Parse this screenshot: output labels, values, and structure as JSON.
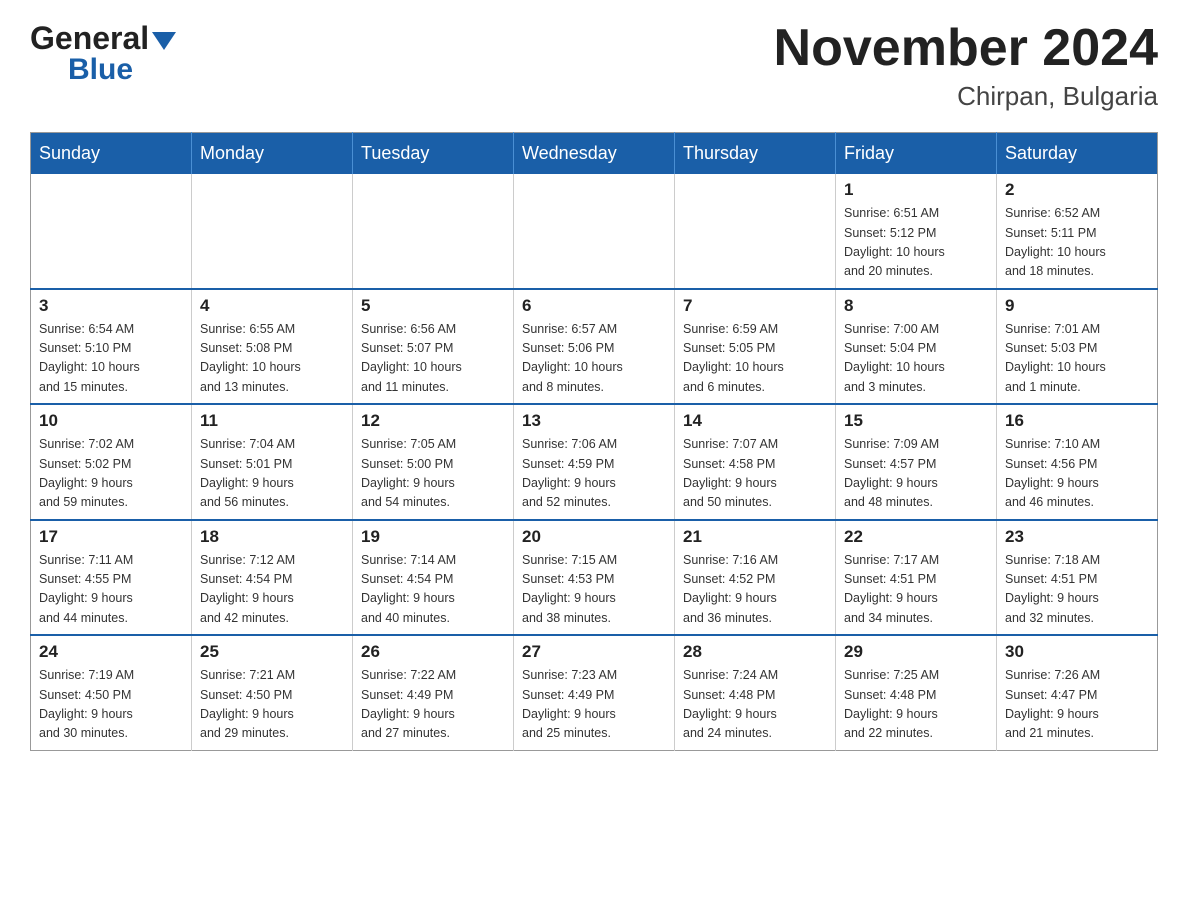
{
  "header": {
    "logo_general": "General",
    "logo_blue": "Blue",
    "month_title": "November 2024",
    "location": "Chirpan, Bulgaria"
  },
  "days_of_week": [
    "Sunday",
    "Monday",
    "Tuesday",
    "Wednesday",
    "Thursday",
    "Friday",
    "Saturday"
  ],
  "weeks": [
    [
      {
        "day": "",
        "info": ""
      },
      {
        "day": "",
        "info": ""
      },
      {
        "day": "",
        "info": ""
      },
      {
        "day": "",
        "info": ""
      },
      {
        "day": "",
        "info": ""
      },
      {
        "day": "1",
        "info": "Sunrise: 6:51 AM\nSunset: 5:12 PM\nDaylight: 10 hours\nand 20 minutes."
      },
      {
        "day": "2",
        "info": "Sunrise: 6:52 AM\nSunset: 5:11 PM\nDaylight: 10 hours\nand 18 minutes."
      }
    ],
    [
      {
        "day": "3",
        "info": "Sunrise: 6:54 AM\nSunset: 5:10 PM\nDaylight: 10 hours\nand 15 minutes."
      },
      {
        "day": "4",
        "info": "Sunrise: 6:55 AM\nSunset: 5:08 PM\nDaylight: 10 hours\nand 13 minutes."
      },
      {
        "day": "5",
        "info": "Sunrise: 6:56 AM\nSunset: 5:07 PM\nDaylight: 10 hours\nand 11 minutes."
      },
      {
        "day": "6",
        "info": "Sunrise: 6:57 AM\nSunset: 5:06 PM\nDaylight: 10 hours\nand 8 minutes."
      },
      {
        "day": "7",
        "info": "Sunrise: 6:59 AM\nSunset: 5:05 PM\nDaylight: 10 hours\nand 6 minutes."
      },
      {
        "day": "8",
        "info": "Sunrise: 7:00 AM\nSunset: 5:04 PM\nDaylight: 10 hours\nand 3 minutes."
      },
      {
        "day": "9",
        "info": "Sunrise: 7:01 AM\nSunset: 5:03 PM\nDaylight: 10 hours\nand 1 minute."
      }
    ],
    [
      {
        "day": "10",
        "info": "Sunrise: 7:02 AM\nSunset: 5:02 PM\nDaylight: 9 hours\nand 59 minutes."
      },
      {
        "day": "11",
        "info": "Sunrise: 7:04 AM\nSunset: 5:01 PM\nDaylight: 9 hours\nand 56 minutes."
      },
      {
        "day": "12",
        "info": "Sunrise: 7:05 AM\nSunset: 5:00 PM\nDaylight: 9 hours\nand 54 minutes."
      },
      {
        "day": "13",
        "info": "Sunrise: 7:06 AM\nSunset: 4:59 PM\nDaylight: 9 hours\nand 52 minutes."
      },
      {
        "day": "14",
        "info": "Sunrise: 7:07 AM\nSunset: 4:58 PM\nDaylight: 9 hours\nand 50 minutes."
      },
      {
        "day": "15",
        "info": "Sunrise: 7:09 AM\nSunset: 4:57 PM\nDaylight: 9 hours\nand 48 minutes."
      },
      {
        "day": "16",
        "info": "Sunrise: 7:10 AM\nSunset: 4:56 PM\nDaylight: 9 hours\nand 46 minutes."
      }
    ],
    [
      {
        "day": "17",
        "info": "Sunrise: 7:11 AM\nSunset: 4:55 PM\nDaylight: 9 hours\nand 44 minutes."
      },
      {
        "day": "18",
        "info": "Sunrise: 7:12 AM\nSunset: 4:54 PM\nDaylight: 9 hours\nand 42 minutes."
      },
      {
        "day": "19",
        "info": "Sunrise: 7:14 AM\nSunset: 4:54 PM\nDaylight: 9 hours\nand 40 minutes."
      },
      {
        "day": "20",
        "info": "Sunrise: 7:15 AM\nSunset: 4:53 PM\nDaylight: 9 hours\nand 38 minutes."
      },
      {
        "day": "21",
        "info": "Sunrise: 7:16 AM\nSunset: 4:52 PM\nDaylight: 9 hours\nand 36 minutes."
      },
      {
        "day": "22",
        "info": "Sunrise: 7:17 AM\nSunset: 4:51 PM\nDaylight: 9 hours\nand 34 minutes."
      },
      {
        "day": "23",
        "info": "Sunrise: 7:18 AM\nSunset: 4:51 PM\nDaylight: 9 hours\nand 32 minutes."
      }
    ],
    [
      {
        "day": "24",
        "info": "Sunrise: 7:19 AM\nSunset: 4:50 PM\nDaylight: 9 hours\nand 30 minutes."
      },
      {
        "day": "25",
        "info": "Sunrise: 7:21 AM\nSunset: 4:50 PM\nDaylight: 9 hours\nand 29 minutes."
      },
      {
        "day": "26",
        "info": "Sunrise: 7:22 AM\nSunset: 4:49 PM\nDaylight: 9 hours\nand 27 minutes."
      },
      {
        "day": "27",
        "info": "Sunrise: 7:23 AM\nSunset: 4:49 PM\nDaylight: 9 hours\nand 25 minutes."
      },
      {
        "day": "28",
        "info": "Sunrise: 7:24 AM\nSunset: 4:48 PM\nDaylight: 9 hours\nand 24 minutes."
      },
      {
        "day": "29",
        "info": "Sunrise: 7:25 AM\nSunset: 4:48 PM\nDaylight: 9 hours\nand 22 minutes."
      },
      {
        "day": "30",
        "info": "Sunrise: 7:26 AM\nSunset: 4:47 PM\nDaylight: 9 hours\nand 21 minutes."
      }
    ]
  ]
}
